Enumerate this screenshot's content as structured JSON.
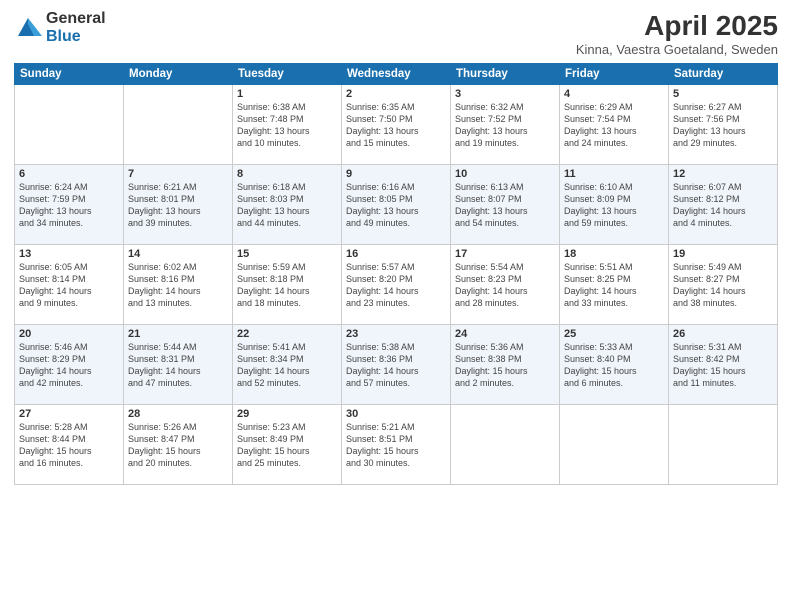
{
  "header": {
    "logo_general": "General",
    "logo_blue": "Blue",
    "title": "April 2025",
    "subtitle": "Kinna, Vaestra Goetaland, Sweden"
  },
  "days_of_week": [
    "Sunday",
    "Monday",
    "Tuesday",
    "Wednesday",
    "Thursday",
    "Friday",
    "Saturday"
  ],
  "weeks": [
    [
      {
        "day": "",
        "info": ""
      },
      {
        "day": "",
        "info": ""
      },
      {
        "day": "1",
        "info": "Sunrise: 6:38 AM\nSunset: 7:48 PM\nDaylight: 13 hours\nand 10 minutes."
      },
      {
        "day": "2",
        "info": "Sunrise: 6:35 AM\nSunset: 7:50 PM\nDaylight: 13 hours\nand 15 minutes."
      },
      {
        "day": "3",
        "info": "Sunrise: 6:32 AM\nSunset: 7:52 PM\nDaylight: 13 hours\nand 19 minutes."
      },
      {
        "day": "4",
        "info": "Sunrise: 6:29 AM\nSunset: 7:54 PM\nDaylight: 13 hours\nand 24 minutes."
      },
      {
        "day": "5",
        "info": "Sunrise: 6:27 AM\nSunset: 7:56 PM\nDaylight: 13 hours\nand 29 minutes."
      }
    ],
    [
      {
        "day": "6",
        "info": "Sunrise: 6:24 AM\nSunset: 7:59 PM\nDaylight: 13 hours\nand 34 minutes."
      },
      {
        "day": "7",
        "info": "Sunrise: 6:21 AM\nSunset: 8:01 PM\nDaylight: 13 hours\nand 39 minutes."
      },
      {
        "day": "8",
        "info": "Sunrise: 6:18 AM\nSunset: 8:03 PM\nDaylight: 13 hours\nand 44 minutes."
      },
      {
        "day": "9",
        "info": "Sunrise: 6:16 AM\nSunset: 8:05 PM\nDaylight: 13 hours\nand 49 minutes."
      },
      {
        "day": "10",
        "info": "Sunrise: 6:13 AM\nSunset: 8:07 PM\nDaylight: 13 hours\nand 54 minutes."
      },
      {
        "day": "11",
        "info": "Sunrise: 6:10 AM\nSunset: 8:09 PM\nDaylight: 13 hours\nand 59 minutes."
      },
      {
        "day": "12",
        "info": "Sunrise: 6:07 AM\nSunset: 8:12 PM\nDaylight: 14 hours\nand 4 minutes."
      }
    ],
    [
      {
        "day": "13",
        "info": "Sunrise: 6:05 AM\nSunset: 8:14 PM\nDaylight: 14 hours\nand 9 minutes."
      },
      {
        "day": "14",
        "info": "Sunrise: 6:02 AM\nSunset: 8:16 PM\nDaylight: 14 hours\nand 13 minutes."
      },
      {
        "day": "15",
        "info": "Sunrise: 5:59 AM\nSunset: 8:18 PM\nDaylight: 14 hours\nand 18 minutes."
      },
      {
        "day": "16",
        "info": "Sunrise: 5:57 AM\nSunset: 8:20 PM\nDaylight: 14 hours\nand 23 minutes."
      },
      {
        "day": "17",
        "info": "Sunrise: 5:54 AM\nSunset: 8:23 PM\nDaylight: 14 hours\nand 28 minutes."
      },
      {
        "day": "18",
        "info": "Sunrise: 5:51 AM\nSunset: 8:25 PM\nDaylight: 14 hours\nand 33 minutes."
      },
      {
        "day": "19",
        "info": "Sunrise: 5:49 AM\nSunset: 8:27 PM\nDaylight: 14 hours\nand 38 minutes."
      }
    ],
    [
      {
        "day": "20",
        "info": "Sunrise: 5:46 AM\nSunset: 8:29 PM\nDaylight: 14 hours\nand 42 minutes."
      },
      {
        "day": "21",
        "info": "Sunrise: 5:44 AM\nSunset: 8:31 PM\nDaylight: 14 hours\nand 47 minutes."
      },
      {
        "day": "22",
        "info": "Sunrise: 5:41 AM\nSunset: 8:34 PM\nDaylight: 14 hours\nand 52 minutes."
      },
      {
        "day": "23",
        "info": "Sunrise: 5:38 AM\nSunset: 8:36 PM\nDaylight: 14 hours\nand 57 minutes."
      },
      {
        "day": "24",
        "info": "Sunrise: 5:36 AM\nSunset: 8:38 PM\nDaylight: 15 hours\nand 2 minutes."
      },
      {
        "day": "25",
        "info": "Sunrise: 5:33 AM\nSunset: 8:40 PM\nDaylight: 15 hours\nand 6 minutes."
      },
      {
        "day": "26",
        "info": "Sunrise: 5:31 AM\nSunset: 8:42 PM\nDaylight: 15 hours\nand 11 minutes."
      }
    ],
    [
      {
        "day": "27",
        "info": "Sunrise: 5:28 AM\nSunset: 8:44 PM\nDaylight: 15 hours\nand 16 minutes."
      },
      {
        "day": "28",
        "info": "Sunrise: 5:26 AM\nSunset: 8:47 PM\nDaylight: 15 hours\nand 20 minutes."
      },
      {
        "day": "29",
        "info": "Sunrise: 5:23 AM\nSunset: 8:49 PM\nDaylight: 15 hours\nand 25 minutes."
      },
      {
        "day": "30",
        "info": "Sunrise: 5:21 AM\nSunset: 8:51 PM\nDaylight: 15 hours\nand 30 minutes."
      },
      {
        "day": "",
        "info": ""
      },
      {
        "day": "",
        "info": ""
      },
      {
        "day": "",
        "info": ""
      }
    ]
  ]
}
